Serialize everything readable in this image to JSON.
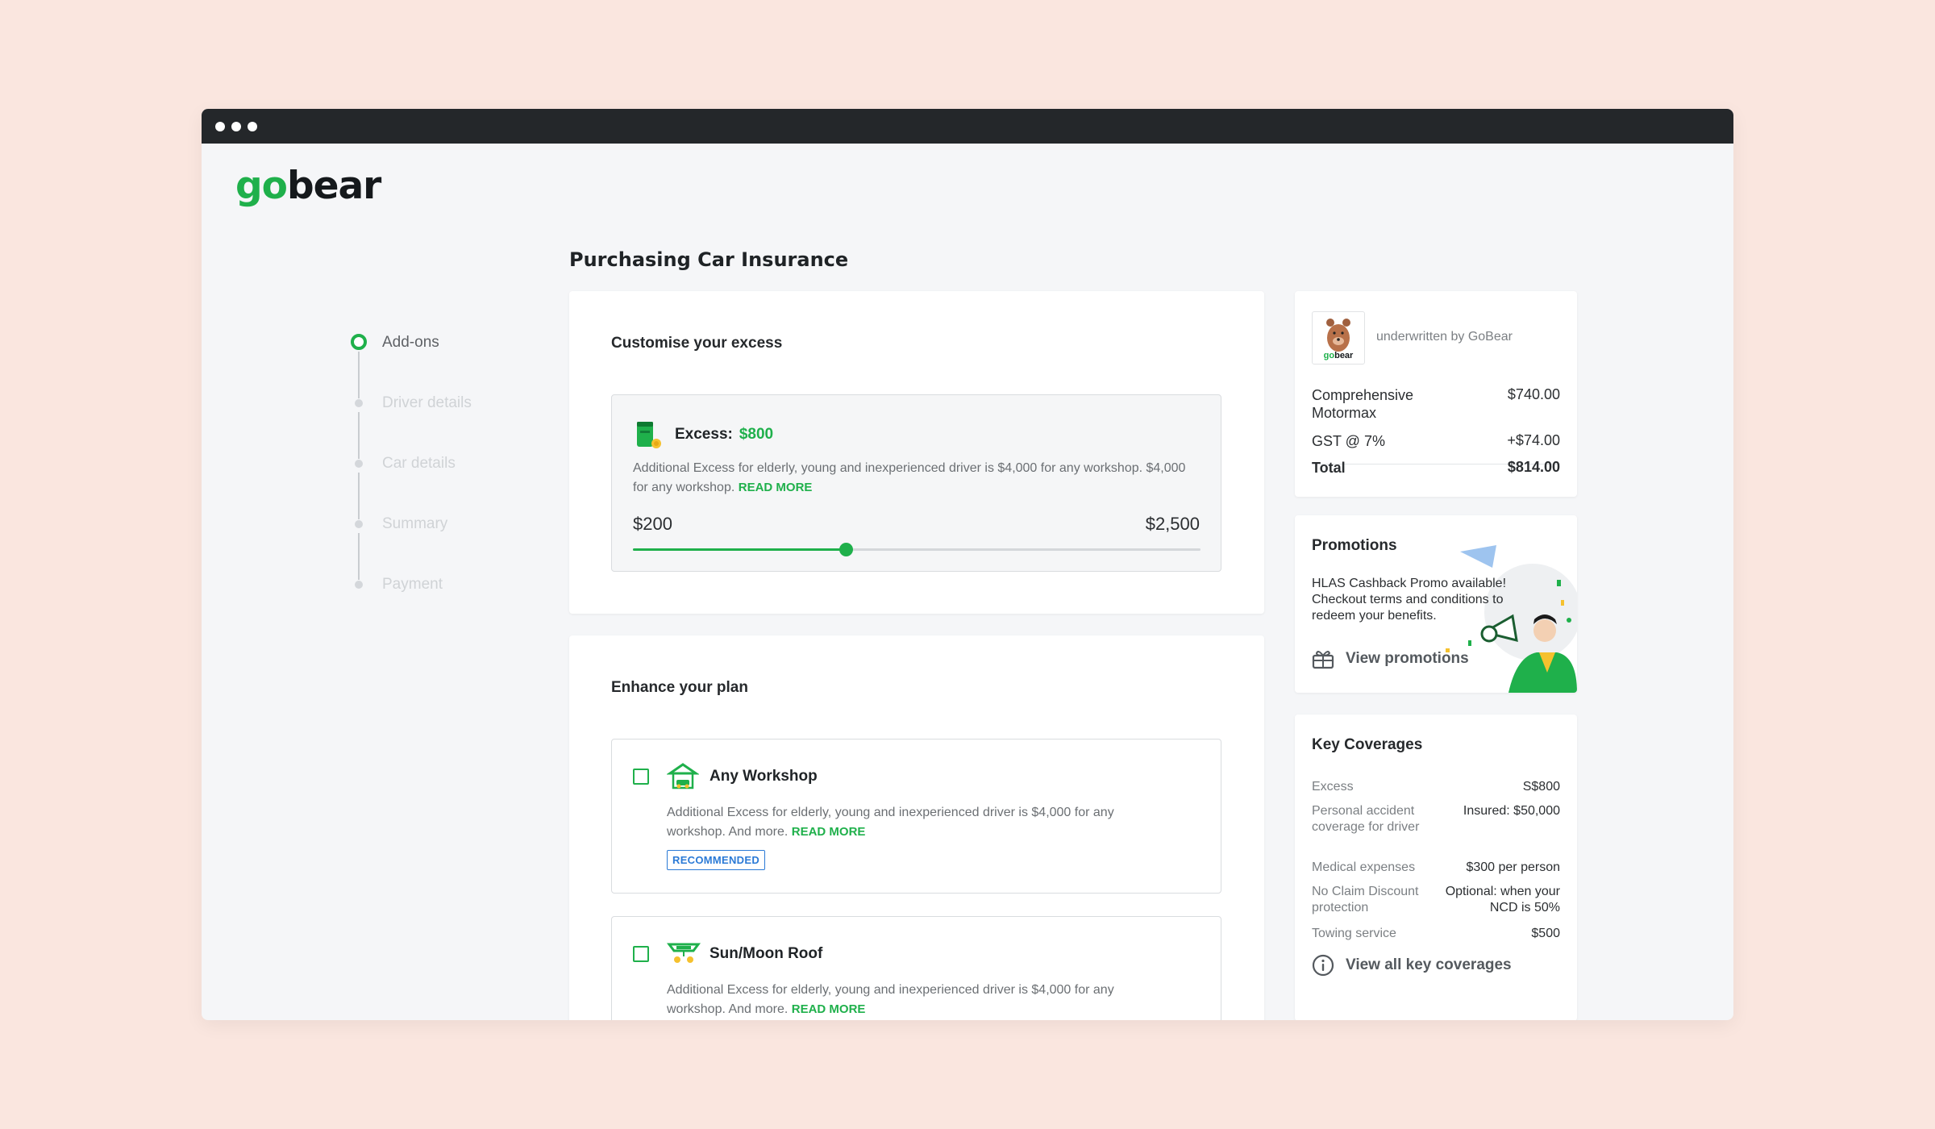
{
  "logo": {
    "part1": "go",
    "part2": "bear"
  },
  "page_title": "Purchasing Car Insurance",
  "steps": [
    {
      "label": "Add-ons",
      "state": "active"
    },
    {
      "label": "Driver details",
      "state": "inactive"
    },
    {
      "label": "Car details",
      "state": "inactive"
    },
    {
      "label": "Summary",
      "state": "inactive"
    },
    {
      "label": "Payment",
      "state": "inactive"
    }
  ],
  "excess": {
    "title": "Customise your excess",
    "label": "Excess:",
    "value": "$800",
    "description": "Additional Excess for elderly, young and inexperienced driver is $4,000 for any workshop. $4,000 for any workshop.",
    "read_more": "READ MORE",
    "min_label": "$200",
    "max_label": "$2,500",
    "slider_fraction": 0.375
  },
  "enhance": {
    "title": "Enhance your plan",
    "addons": [
      {
        "name": "Any Workshop",
        "description": "Additional Excess for elderly, young and inexperienced driver is $4,000 for any workshop. And more.",
        "read_more": "READ MORE",
        "badge": "RECOMMENDED",
        "checked": false
      },
      {
        "name": "Sun/Moon Roof",
        "description": "Additional Excess for elderly, young and inexperienced driver is $4,000 for any workshop. And more.",
        "read_more": "READ MORE",
        "checked": false
      }
    ]
  },
  "summary": {
    "insurer_logo_text": "gobear",
    "underwritten": "underwritten by GoBear",
    "rows": [
      {
        "label": "Comprehensive Motormax",
        "value": "$740.00"
      },
      {
        "label": "GST @ 7%",
        "value": "+$74.00"
      }
    ],
    "total_label": "Total",
    "total_value": "$814.00"
  },
  "promotions": {
    "title": "Promotions",
    "text": "HLAS Cashback Promo available! Checkout terms and conditions to redeem your benefits.",
    "link": "View promotions"
  },
  "coverages": {
    "title": "Key Coverages",
    "rows": [
      {
        "label": "Excess",
        "value": "S$800"
      },
      {
        "label": "Personal accident coverage for driver",
        "value": "Insured: $50,000"
      },
      {
        "label": "Medical expenses",
        "value": "$300 per person"
      },
      {
        "label": "No Claim Discount protection",
        "value": "Optional: when your NCD is 50%"
      },
      {
        "label": "Towing service",
        "value": "$500"
      }
    ],
    "link": "View all key coverages"
  },
  "colors": {
    "accent": "#1fb04b",
    "badge": "#2b7ad6",
    "background": "#fae6df"
  }
}
